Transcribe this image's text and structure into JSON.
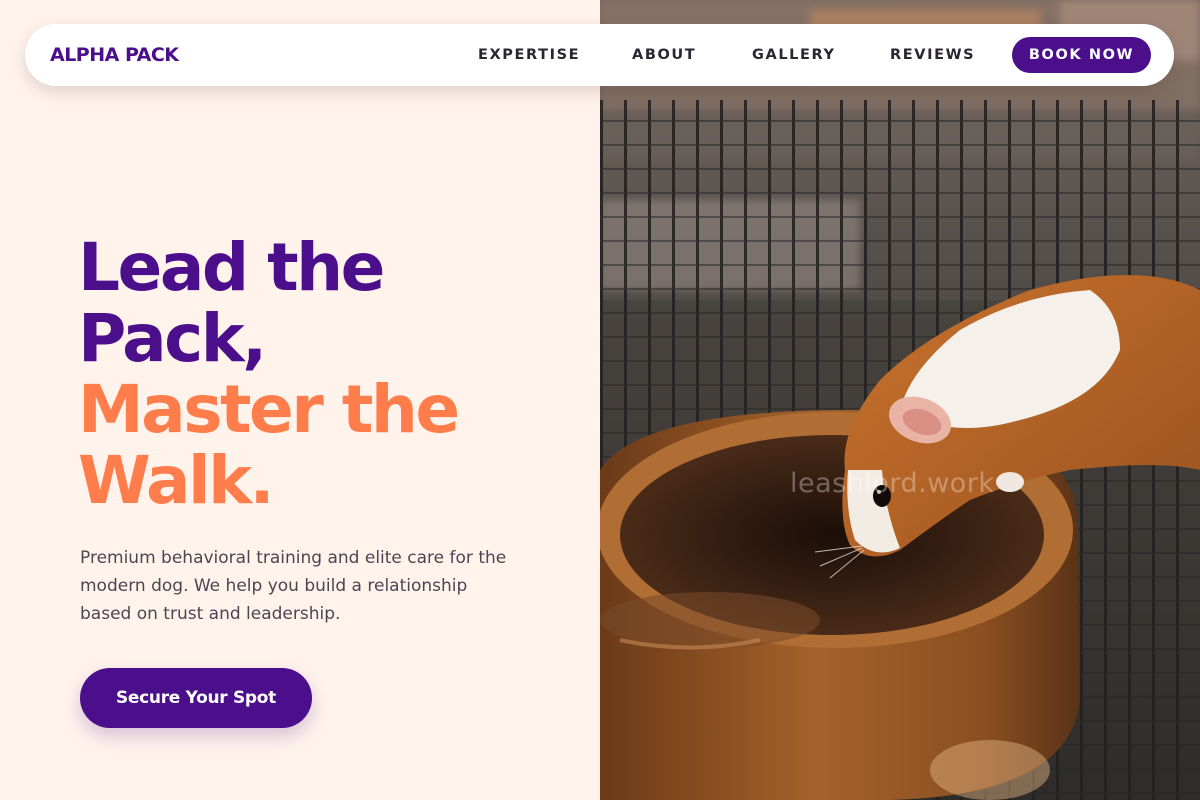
{
  "brand": {
    "name": "ALPHA PACK",
    "primary_color": "#4b0f8c",
    "accent_color": "#ff7d4a",
    "background_color": "#fff3ec"
  },
  "nav": {
    "links": [
      "EXPERTISE",
      "ABOUT",
      "GALLERY",
      "REVIEWS"
    ],
    "cta_label": "BOOK NOW"
  },
  "hero": {
    "headline_line1": "Lead the",
    "headline_line2": "Pack,",
    "headline_line3": "Master the",
    "headline_line4": "Walk.",
    "subtext": "Premium behavioral training and elite care for the modern dog. We help you build a relationship based on trust and leadership.",
    "cta_label": "Secure Your Spot",
    "image_subject": "guinea-pig-drinking-from-clay-bowl-photo",
    "watermark": "leashlord.work"
  }
}
